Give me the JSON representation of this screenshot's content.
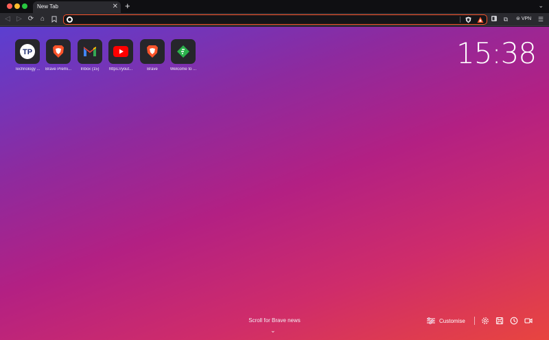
{
  "tab": {
    "title": "New Tab"
  },
  "urlbar": {
    "value": "",
    "placeholder": ""
  },
  "toolbar": {
    "vpn_label": "VPN"
  },
  "top_sites": [
    {
      "label": "Technology ...",
      "icon": "technology-personalized-icon"
    },
    {
      "label": "Brave Premi...",
      "icon": "brave-lion-icon"
    },
    {
      "label": "Inbox (15)",
      "icon": "gmail-icon"
    },
    {
      "label": "https://yout...",
      "icon": "youtube-icon"
    },
    {
      "label": "Brave",
      "icon": "brave-lion-icon"
    },
    {
      "label": "Welcome to ...",
      "icon": "feedly-icon"
    }
  ],
  "top_site_1_logo_text": "TP",
  "clock": "15:38",
  "scroll_news": "Scroll for Brave news",
  "customise": {
    "label": "Customise"
  },
  "colors": {
    "accent": "#fb542b",
    "toolbar": "#2a2a2f",
    "tabstrip": "#0f0f12",
    "tile": "#26262b"
  }
}
